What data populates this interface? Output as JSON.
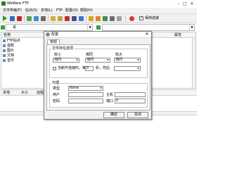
{
  "app": {
    "title": "WeWare FTP"
  },
  "window": {
    "min": "–",
    "max": "□",
    "close": "✕"
  },
  "menu": [
    "文件传输(F)",
    "站点(S)",
    "本地(L)",
    "FTP",
    "配置(O)",
    "帮助(H)"
  ],
  "toolbar": {
    "show_connection_label": "保持连接",
    "show_connection_checked": true
  },
  "local": {
    "path": "桌",
    "columns": [
      "名称"
    ],
    "tree": [
      "FTP站点",
      "视频",
      "图片",
      "文档",
      "音乐"
    ]
  },
  "remote": {
    "columns": [
      "属性"
    ]
  },
  "lower": {
    "columns": [
      "本地",
      "大小",
      "远程"
    ]
  },
  "dialog": {
    "title": "配置",
    "tab": "常规",
    "cache_group": "文件存在选项",
    "col_small": "较小",
    "col_equal": "相同",
    "col_large": "较大",
    "small_value": "询问",
    "equal_value": "询问",
    "large_value": "询问",
    "retry_label": "当断开连接时，等待",
    "retry_seconds": "0",
    "retry_suffix": "秒，然后",
    "proxy_group": "代理",
    "type_label": "类型",
    "type_value": "None",
    "user_label": "用户",
    "host_label": "主机",
    "password_label": "密码",
    "port_label": "端口",
    "port_value": "0",
    "ok": "确定",
    "close": "关闭"
  },
  "colors": {
    "accent": "#2d7a2d",
    "dialog_bg": "#f0f0f0"
  },
  "icons": [
    "app-icon",
    "play-icon",
    "stop-icon",
    "delete-icon",
    "folder-icon",
    "gear-icon",
    "up-folder-icon"
  ]
}
